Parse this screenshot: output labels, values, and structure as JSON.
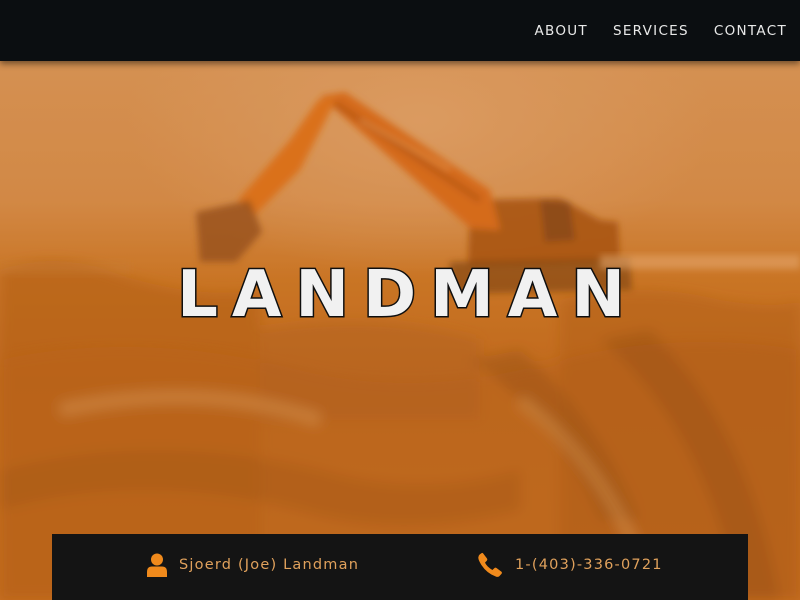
{
  "nav": {
    "items": [
      {
        "label": "ABOUT"
      },
      {
        "label": "SERVICES"
      },
      {
        "label": "CONTACT"
      }
    ]
  },
  "hero": {
    "title": "LANDMAN"
  },
  "contact": {
    "name": "Sjoerd (Joe) Landman",
    "phone": "1-(403)-336-0721",
    "icons": {
      "person": "person-icon",
      "phone": "phone-icon"
    }
  },
  "colors": {
    "nav_background": "#0b0e11",
    "nav_text": "#e9e9e9",
    "accent_orange": "#f08a1c",
    "contact_text": "#e0a15c",
    "contact_bar": "#141414",
    "title_fill": "#f1f1f1",
    "title_outline": "#111111"
  }
}
